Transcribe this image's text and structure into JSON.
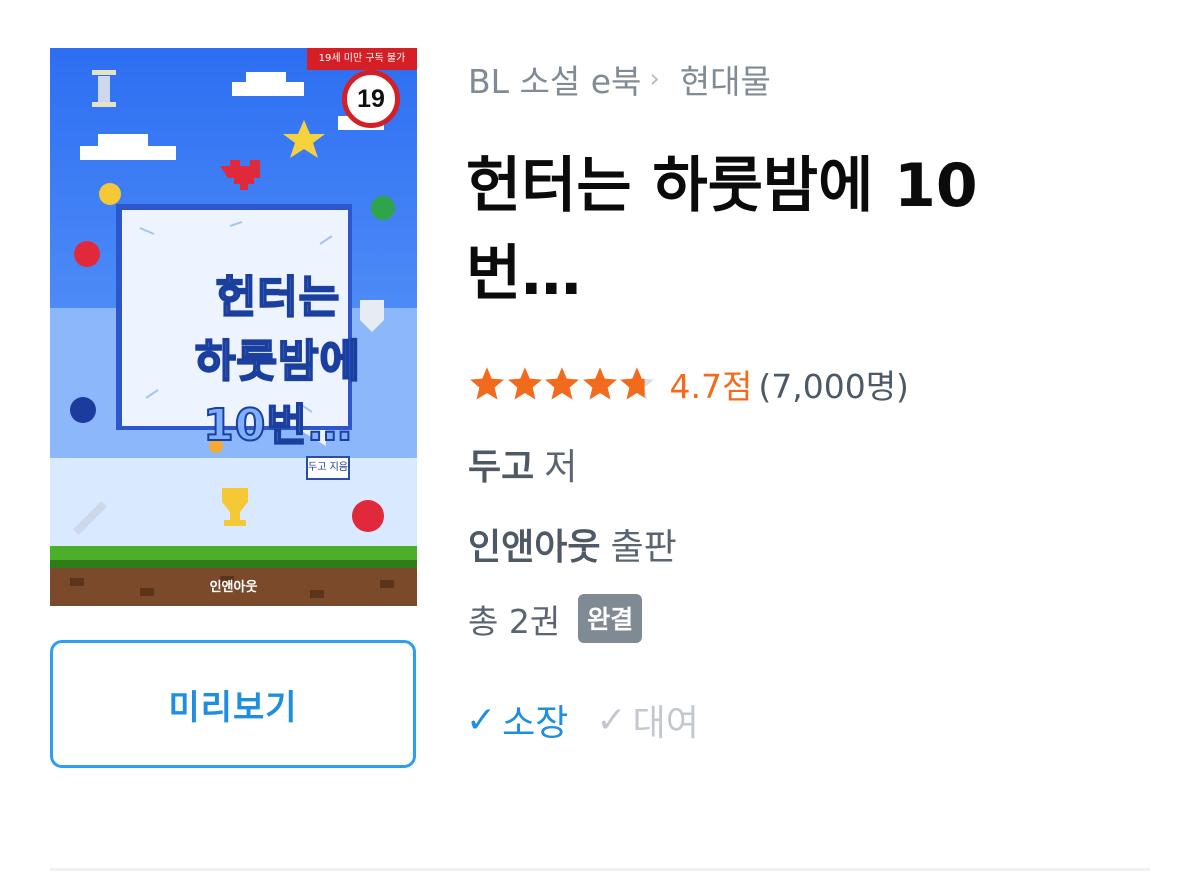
{
  "cover": {
    "age_banner": "19세 미만 구독 불가",
    "age_badge": "19",
    "title_lines": [
      "헌터는",
      "하룻밤에",
      "10번…"
    ],
    "author_tag": "두고 지음",
    "publisher_logo": "인앤아웃"
  },
  "preview_button": "미리보기",
  "breadcrumb": {
    "category": "BL 소설 e북",
    "separator": "›",
    "subcategory": "현대물"
  },
  "title": "헌터는 하룻밤에 10 번…",
  "rating": {
    "stars": 4.7,
    "max_stars": 5,
    "score_text": "4.7점",
    "count_text": "(7,000명)",
    "star_color": "#f26b1d"
  },
  "author": {
    "name": "두고",
    "suffix": "저"
  },
  "publisher": {
    "name": "인앤아웃",
    "suffix": "출판"
  },
  "volumes": {
    "text": "총 2권",
    "status_badge": "완결"
  },
  "options": [
    {
      "check": "✓",
      "label": "소장",
      "selected": true
    },
    {
      "check": "✓",
      "label": "대여",
      "selected": false
    }
  ],
  "colors": {
    "accent_blue": "#1e8fe0",
    "rating_orange": "#f26b1d",
    "badge_gray": "#7f8a95"
  }
}
